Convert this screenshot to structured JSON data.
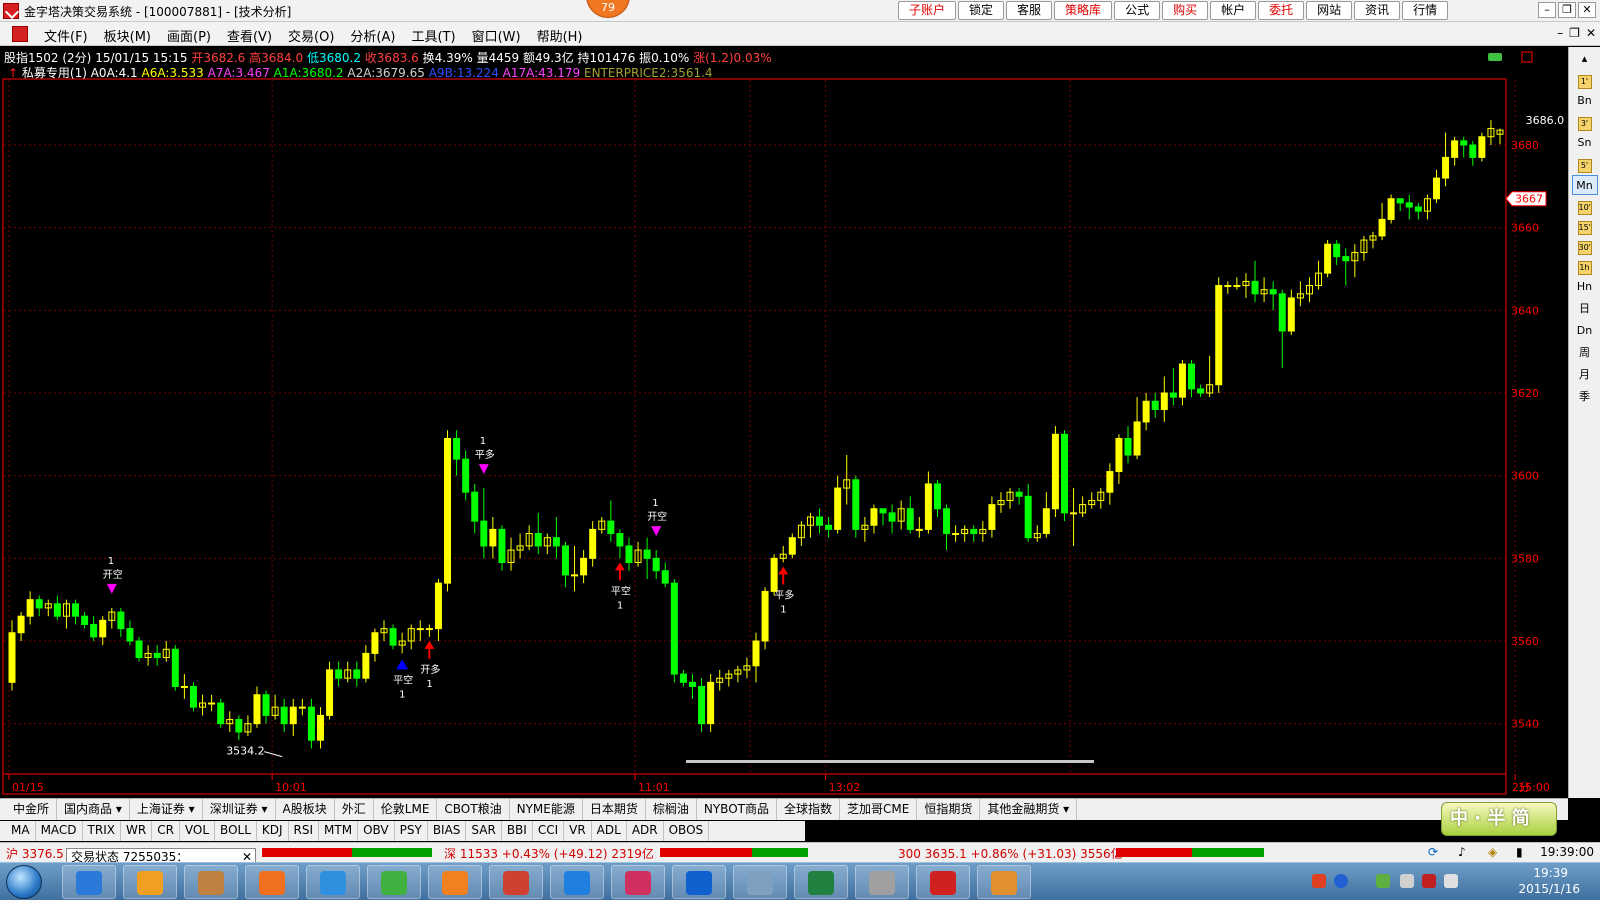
{
  "titlebar": {
    "title": "金字塔决策交易系统 - [100007881] - [技术分析]",
    "notify_count": "79",
    "buttons": [
      "子账户",
      "锁定",
      "客服",
      "策略库",
      "公式",
      "购买",
      "帐户",
      "委托",
      "网站",
      "资讯",
      "行情"
    ],
    "red_buttons": [
      "子账户",
      "策略库",
      "购买",
      "委托"
    ]
  },
  "menubar": {
    "items": [
      "文件(F)",
      "板块(M)",
      "画面(P)",
      "查看(V)",
      "交易(O)",
      "分析(A)",
      "工具(T)",
      "窗口(W)",
      "帮助(H)"
    ]
  },
  "quote": {
    "symbol": "股指1502 (2分)",
    "datetime": "15/01/15 15:15",
    "open": "开3682.6",
    "high": "高3684.0",
    "low": "低3680.2",
    "close": "收3683.6",
    "turnover_rate": "换4.39%",
    "volume": "量4459",
    "amount": "额49.3亿",
    "open_interest": "持101476",
    "amplitude": "振0.10%",
    "change": "涨(1.2)0.03%"
  },
  "indicator_line": {
    "strategy": "私募专用(1)",
    "A0A": "A0A:4.1",
    "A6A": "A6A:3.533",
    "A7A": "A7A:3.467",
    "A1A": "A1A:3680.2",
    "A2A": "A2A:3679.65",
    "A9B": "A9B:13.224",
    "A17A": "A17A:43.179",
    "ENTERPRICE2": "ENTERPRICE2:3561.4"
  },
  "colors": {
    "up": "#ffff00",
    "down": "#00ff00",
    "axis": "#ff0000",
    "grid": "#7a0000",
    "buy_marker": "#ff0000",
    "sell_marker": "#ff00ff",
    "cover_marker": "#0000ff"
  },
  "chart_data": {
    "type": "candlestick",
    "ylim": [
      3530,
      3695
    ],
    "yticks": [
      3540,
      3560,
      3580,
      3600,
      3620,
      3640,
      3660,
      3680
    ],
    "price_tag": "3667",
    "price_tag_value": 3667,
    "xticks": [
      {
        "label": "01/15",
        "index": 0
      },
      {
        "label": "10:01",
        "index": 29
      },
      {
        "label": "11:01",
        "index": 69
      },
      {
        "label": "13:02",
        "index": 90
      },
      {
        "label": "15:00",
        "index": 166
      }
    ],
    "period_label": "2分",
    "annotations": [
      {
        "text": "3534.2",
        "index": 30,
        "value": 3534.2
      },
      {
        "text": "3686.0",
        "index": 173,
        "value": 3686.0
      }
    ],
    "signals": [
      {
        "index": 11,
        "type": "sell",
        "label": "开空",
        "qty": "1"
      },
      {
        "index": 43,
        "type": "cover",
        "label": "平空",
        "qty": "1"
      },
      {
        "index": 46,
        "type": "buy",
        "label": "开多",
        "qty": "1"
      },
      {
        "index": 52,
        "type": "sell",
        "label": "平多",
        "qty": "1"
      },
      {
        "index": 67,
        "type": "buy",
        "label": "平空",
        "qty": "1"
      },
      {
        "index": 71,
        "type": "sell",
        "label": "开空",
        "qty": "1"
      },
      {
        "index": 85,
        "type": "buy",
        "label": "平多",
        "qty": "1"
      }
    ],
    "candles": [
      [
        3550,
        3562,
        3548,
        3565
      ],
      [
        3562,
        3566,
        3560,
        3567
      ],
      [
        3566,
        3570,
        3564,
        3572
      ],
      [
        3570,
        3568,
        3566,
        3571
      ],
      [
        3568,
        3569,
        3566,
        3570
      ],
      [
        3569,
        3566,
        3565,
        3571
      ],
      [
        3566,
        3569,
        3563,
        3570
      ],
      [
        3569,
        3566,
        3564,
        3570
      ],
      [
        3566,
        3564,
        3563,
        3567
      ],
      [
        3564,
        3561,
        3560,
        3566
      ],
      [
        3561,
        3565,
        3559,
        3566
      ],
      [
        3565,
        3567,
        3563,
        3568
      ],
      [
        3567,
        3563,
        3561,
        3568
      ],
      [
        3563,
        3560,
        3559,
        3565
      ],
      [
        3560,
        3556,
        3555,
        3561
      ],
      [
        3556,
        3557,
        3554,
        3559
      ],
      [
        3557,
        3556,
        3554,
        3559
      ],
      [
        3556,
        3558,
        3555,
        3560
      ],
      [
        3558,
        3549,
        3548,
        3559
      ],
      [
        3549,
        3549,
        3546,
        3552
      ],
      [
        3549,
        3544,
        3543,
        3550
      ],
      [
        3544,
        3545,
        3542,
        3547
      ],
      [
        3545,
        3545,
        3543,
        3547
      ],
      [
        3545,
        3540,
        3539,
        3546
      ],
      [
        3540,
        3541,
        3538,
        3543
      ],
      [
        3541,
        3538,
        3536,
        3542
      ],
      [
        3538,
        3540,
        3537,
        3542
      ],
      [
        3540,
        3547,
        3539,
        3549
      ],
      [
        3547,
        3542,
        3540,
        3548
      ],
      [
        3542,
        3544,
        3541,
        3547
      ],
      [
        3544,
        3540,
        3538,
        3546
      ],
      [
        3540,
        3544,
        3537,
        3546
      ],
      [
        3544,
        3544,
        3542,
        3546
      ],
      [
        3544,
        3536,
        3534,
        3546
      ],
      [
        3536,
        3542,
        3534,
        3544
      ],
      [
        3542,
        3553,
        3541,
        3555
      ],
      [
        3553,
        3551,
        3549,
        3555
      ],
      [
        3551,
        3553,
        3550,
        3555
      ],
      [
        3553,
        3551,
        3549,
        3555
      ],
      [
        3551,
        3557,
        3550,
        3559
      ],
      [
        3557,
        3562,
        3555,
        3563
      ],
      [
        3562,
        3563,
        3560,
        3565
      ],
      [
        3563,
        3559,
        3558,
        3564
      ],
      [
        3559,
        3560,
        3557,
        3562
      ],
      [
        3560,
        3563,
        3558,
        3564
      ],
      [
        3563,
        3563,
        3560,
        3565
      ],
      [
        3563,
        3563,
        3561,
        3564
      ],
      [
        3563,
        3574,
        3560,
        3575
      ],
      [
        3574,
        3609,
        3572,
        3611
      ],
      [
        3609,
        3604,
        3600,
        3611
      ],
      [
        3604,
        3596,
        3594,
        3606
      ],
      [
        3596,
        3589,
        3586,
        3598
      ],
      [
        3589,
        3583,
        3580,
        3597
      ],
      [
        3583,
        3587,
        3580,
        3590
      ],
      [
        3587,
        3579,
        3577,
        3588
      ],
      [
        3579,
        3582,
        3577,
        3585
      ],
      [
        3582,
        3583,
        3580,
        3586
      ],
      [
        3583,
        3586,
        3582,
        3588
      ],
      [
        3586,
        3583,
        3581,
        3591
      ],
      [
        3583,
        3585,
        3581,
        3586
      ],
      [
        3585,
        3583,
        3580,
        3590
      ],
      [
        3583,
        3576,
        3573,
        3584
      ],
      [
        3576,
        3576,
        3572,
        3583
      ],
      [
        3576,
        3580,
        3574,
        3582
      ],
      [
        3580,
        3587,
        3578,
        3589
      ],
      [
        3587,
        3589,
        3586,
        3590
      ],
      [
        3589,
        3586,
        3584,
        3594
      ],
      [
        3586,
        3583,
        3580,
        3587
      ],
      [
        3583,
        3579,
        3577,
        3585
      ],
      [
        3579,
        3582,
        3578,
        3584
      ],
      [
        3582,
        3580,
        3575,
        3585
      ],
      [
        3580,
        3577,
        3575,
        3582
      ],
      [
        3577,
        3574,
        3573,
        3579
      ],
      [
        3574,
        3552,
        3550,
        3575
      ],
      [
        3552,
        3550,
        3549,
        3553
      ],
      [
        3550,
        3549,
        3546,
        3552
      ],
      [
        3549,
        3540,
        3538,
        3551
      ],
      [
        3540,
        3550,
        3538,
        3552
      ],
      [
        3550,
        3551,
        3548,
        3553
      ],
      [
        3551,
        3552,
        3549,
        3553
      ],
      [
        3552,
        3553,
        3550,
        3554
      ],
      [
        3553,
        3554,
        3551,
        3556
      ],
      [
        3554,
        3560,
        3550,
        3562
      ],
      [
        3560,
        3572,
        3558,
        3573
      ],
      [
        3572,
        3580,
        3571,
        3581
      ],
      [
        3580,
        3581,
        3579,
        3583
      ],
      [
        3581,
        3585,
        3580,
        3586
      ],
      [
        3585,
        3588,
        3583,
        3589
      ],
      [
        3588,
        3590,
        3585,
        3591
      ],
      [
        3590,
        3588,
        3586,
        3592
      ],
      [
        3588,
        3587,
        3585,
        3590
      ],
      [
        3587,
        3597,
        3586,
        3600
      ],
      [
        3597,
        3599,
        3593,
        3605
      ],
      [
        3599,
        3587,
        3585,
        3600
      ],
      [
        3587,
        3588,
        3584,
        3590
      ],
      [
        3588,
        3592,
        3586,
        3593
      ],
      [
        3592,
        3591,
        3588,
        3592
      ],
      [
        3591,
        3589,
        3586,
        3593
      ],
      [
        3589,
        3592,
        3587,
        3594
      ],
      [
        3592,
        3587,
        3586,
        3595
      ],
      [
        3587,
        3587,
        3585,
        3590
      ],
      [
        3587,
        3598,
        3586,
        3601
      ],
      [
        3598,
        3592,
        3590,
        3599
      ],
      [
        3592,
        3586,
        3582,
        3593
      ],
      [
        3586,
        3586,
        3584,
        3588
      ],
      [
        3586,
        3587,
        3584,
        3588
      ],
      [
        3587,
        3586,
        3584,
        3588
      ],
      [
        3586,
        3587,
        3584,
        3589
      ],
      [
        3587,
        3593,
        3585,
        3595
      ],
      [
        3593,
        3594,
        3591,
        3596
      ],
      [
        3594,
        3596,
        3592,
        3597
      ],
      [
        3596,
        3595,
        3593,
        3597
      ],
      [
        3595,
        3585,
        3584,
        3598
      ],
      [
        3585,
        3586,
        3584,
        3588
      ],
      [
        3586,
        3592,
        3585,
        3596
      ],
      [
        3592,
        3610,
        3590,
        3612
      ],
      [
        3610,
        3591,
        3589,
        3611
      ],
      [
        3591,
        3591,
        3583,
        3597
      ],
      [
        3591,
        3593,
        3590,
        3595
      ],
      [
        3593,
        3594,
        3592,
        3596
      ],
      [
        3594,
        3596,
        3592,
        3597
      ],
      [
        3596,
        3601,
        3593,
        3603
      ],
      [
        3601,
        3609,
        3598,
        3610
      ],
      [
        3609,
        3605,
        3603,
        3612
      ],
      [
        3605,
        3613,
        3604,
        3619
      ],
      [
        3613,
        3618,
        3611,
        3620
      ],
      [
        3618,
        3616,
        3614,
        3620
      ],
      [
        3616,
        3620,
        3613,
        3624
      ],
      [
        3620,
        3619,
        3617,
        3626
      ],
      [
        3619,
        3627,
        3617,
        3628
      ],
      [
        3627,
        3621,
        3619,
        3628
      ],
      [
        3621,
        3620,
        3619,
        3622
      ],
      [
        3620,
        3622,
        3619,
        3629
      ],
      [
        3622,
        3646,
        3620,
        3648
      ],
      [
        3646,
        3646,
        3644,
        3647
      ],
      [
        3646,
        3646,
        3645,
        3648
      ],
      [
        3646,
        3647,
        3643,
        3649
      ],
      [
        3647,
        3644,
        3642,
        3652
      ],
      [
        3644,
        3645,
        3642,
        3648
      ],
      [
        3645,
        3644,
        3640,
        3647
      ],
      [
        3644,
        3635,
        3626,
        3645
      ],
      [
        3635,
        3643,
        3634,
        3645
      ],
      [
        3643,
        3644,
        3641,
        3647
      ],
      [
        3644,
        3646,
        3642,
        3648
      ],
      [
        3646,
        3649,
        3645,
        3652
      ],
      [
        3649,
        3656,
        3648,
        3657
      ],
      [
        3656,
        3653,
        3651,
        3657
      ],
      [
        3653,
        3652,
        3646,
        3655
      ],
      [
        3652,
        3654,
        3648,
        3656
      ],
      [
        3654,
        3657,
        3652,
        3658
      ],
      [
        3657,
        3658,
        3655,
        3659
      ],
      [
        3658,
        3662,
        3657,
        3666
      ],
      [
        3662,
        3667,
        3661,
        3668
      ],
      [
        3667,
        3666,
        3664,
        3667
      ],
      [
        3666,
        3665,
        3662,
        3668
      ],
      [
        3665,
        3664,
        3662,
        3666
      ],
      [
        3664,
        3667,
        3662,
        3668
      ],
      [
        3667,
        3672,
        3666,
        3674
      ],
      [
        3672,
        3677,
        3670,
        3683
      ],
      [
        3677,
        3681,
        3675,
        3682
      ],
      [
        3681,
        3680,
        3677,
        3682
      ],
      [
        3680,
        3677,
        3675,
        3681
      ],
      [
        3677,
        3682,
        3676,
        3683
      ],
      [
        3682,
        3684,
        3680,
        3686
      ],
      [
        3682.6,
        3683.6,
        3680.2,
        3684.0
      ]
    ]
  },
  "period_buttons": [
    "Bn",
    "Sn",
    "Mn",
    "Hn",
    "日",
    "Dn",
    "周",
    "月",
    "季"
  ],
  "period_selected": "Mn",
  "period_icons": [
    "1'",
    "3'",
    "5'",
    "10'",
    "15'",
    "30'",
    "1h"
  ],
  "category_tabs": [
    "中金所",
    "国内商品 ▾",
    "上海证券 ▾",
    "深圳证券 ▾",
    "A股板块",
    "外汇",
    "伦敦LME",
    "CBOT粮油",
    "NYME能源",
    "日本期货",
    "棕榈油",
    "NYBOT商品",
    "全球指数",
    "芝加哥CME",
    "恒指期货",
    "其他金融期货 ▾"
  ],
  "indicator_tabs": [
    "MA",
    "MACD",
    "TRIX",
    "WR",
    "CR",
    "VOL",
    "BOLL",
    "KDJ",
    "RSI",
    "MTM",
    "OBV",
    "PSY",
    "BIAS",
    "SAR",
    "BBI",
    "CCI",
    "VR",
    "ADL",
    "ADR",
    "OBOS"
  ],
  "ime": {
    "label": "中 · 半 简"
  },
  "status": {
    "sh": "沪 3376.5",
    "popup": "交易状态 7255035：",
    "sz": "深 11533 +0.43% (+49.12) 2319亿",
    "hs300": "300 3635.1 +0.86% (+31.03) 3556亿",
    "time": "19:39:00"
  },
  "taskbar": {
    "clock_time": "19:39",
    "clock_date": "2015/1/16"
  }
}
